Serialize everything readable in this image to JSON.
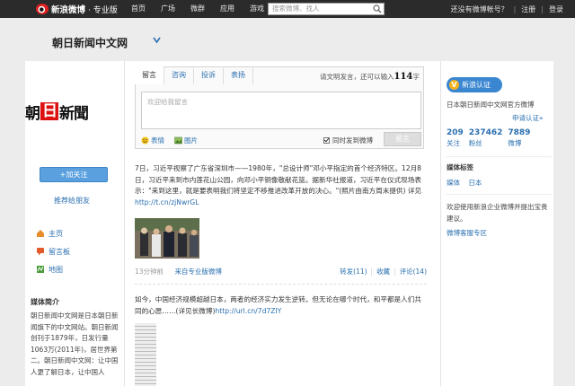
{
  "topbar": {
    "logo_text": "新浪微博",
    "logo_sub": "· 专业版",
    "nav": [
      "首页",
      "广场",
      "微群",
      "应用",
      "游戏"
    ],
    "search_placeholder": "搜索微博、找人",
    "register_prompt": "还没有微博帐号？",
    "register": "注册",
    "login": "登录"
  },
  "header": {
    "title": "朝日新闻中文网"
  },
  "left": {
    "logo_parts": [
      "朝",
      "日",
      "新聞"
    ],
    "follow_button": "+加关注",
    "recommend": "推荐给朋友",
    "links": [
      "主页",
      "留言板",
      "地图"
    ],
    "media_head": "媒体简介",
    "media_text": "朝日新闻中文网是日本朝日新闻旗下的中文网站。朝日新闻创刊于1879年，日发行量1063万(2011年)，居世界第二。朝日新闻中文网：让中国人更了解日本，让中国人"
  },
  "compose": {
    "tabs": [
      "留言",
      "咨询",
      "投诉",
      "表扬"
    ],
    "hint_prefix": "请文明发言，还可以输入",
    "hint_count": "114",
    "hint_suffix": "字",
    "placeholder": "欢迎给我留言",
    "emoji": "表情",
    "image": "图片",
    "sync": "同时发到微博",
    "post": "留言"
  },
  "feed": {
    "post1_text": "7日，习近平视察了广东省深圳市——1980年，\"总设计师\"邓小平指定的首个经济特区。12月8日，习近平来到市内莲花山公园，向邓小平铜像敬献花篮。据新华社报道，习近平在仪式现场表示：\"来到这里，就是要表明我们将坚定不移推进改革开放的决心。\"(照片由南方周末提供) 详见",
    "post1_link": "http://t.cn/zjNwrGL",
    "post1_time": "13分钟前",
    "post1_source": "来自专业版微博",
    "repost": "转发(11)",
    "favorite": "收藏",
    "comment": "评论(14)",
    "post2_text": "如今，中国经济规模超越日本，两者的经济实力发生逆转。但无论在哪个时代，和平都是人们共同的心愿……(详见长微博)",
    "post2_link": "http://url.cn/7d7ZIY"
  },
  "right": {
    "verify": "新浪认证",
    "official": "日本朝日新闻中文网官方微博",
    "apply": "申请认证»",
    "stats": [
      {
        "number": "209",
        "label": "关注"
      },
      {
        "number": "237462",
        "label": "粉丝"
      },
      {
        "number": "7889",
        "label": "微博"
      }
    ],
    "tags_head": "媒体标签",
    "tags": [
      "媒体",
      "日本"
    ],
    "welcome": "欢迎使用新浪企业微博并提出宝贵建议。",
    "support": "微博客服专区"
  },
  "colors": {
    "topbar": "#2b2b2b",
    "link": "#2a6fb0",
    "accent": "#3a86d1",
    "follow": "#5aa0de"
  }
}
